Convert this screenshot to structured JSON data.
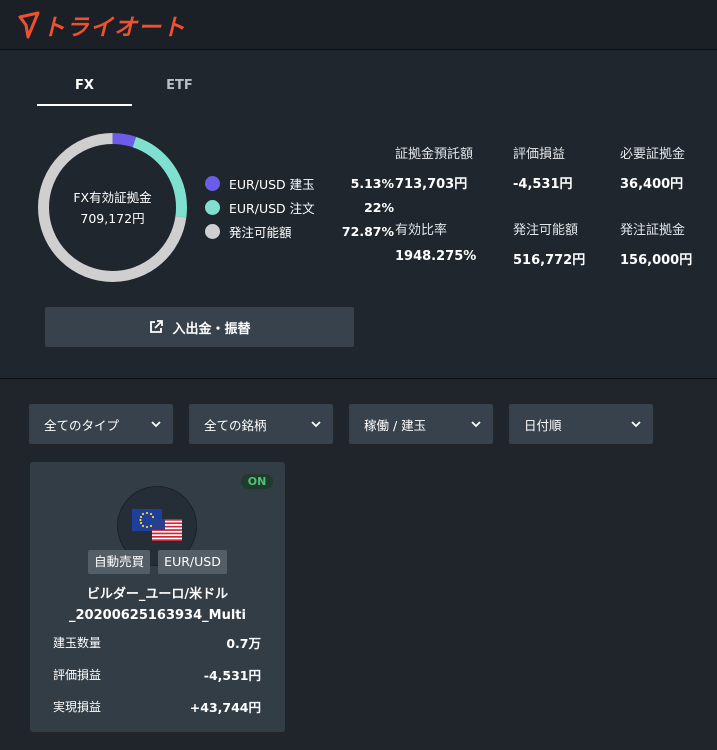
{
  "header": {
    "logo_text": "トライオート"
  },
  "tabs": [
    {
      "label": "FX",
      "active": true
    },
    {
      "label": "ETF",
      "active": false
    }
  ],
  "summary": {
    "donut_title": "FX有効証拠金",
    "donut_value": "709,172円",
    "legend": [
      {
        "label": "EUR/USD 建玉",
        "value": "5.13%",
        "percent": 5.13,
        "color": "#6c5ce7"
      },
      {
        "label": "EUR/USD 注文",
        "value": "22%",
        "percent": 22,
        "color": "#7fe0cf"
      },
      {
        "label": "発注可能額",
        "value": "72.87%",
        "percent": 72.87,
        "color": "#cfcfcf"
      }
    ]
  },
  "stats": [
    {
      "label": "証拠金預託額",
      "value": "713,703円"
    },
    {
      "label": "評価損益",
      "value": "-4,531円"
    },
    {
      "label": "必要証拠金",
      "value": "36,400円"
    },
    {
      "label": "有効比率",
      "value": "1948.275%"
    },
    {
      "label": "発注可能額",
      "value": "516,772円"
    },
    {
      "label": "発注証拠金",
      "value": "156,000円"
    }
  ],
  "deposit_button": {
    "label": "入出金・振替",
    "icon": "external-link-icon"
  },
  "filters": [
    {
      "label": "全てのタイプ"
    },
    {
      "label": "全ての銘柄"
    },
    {
      "label": "稼働 / 建玉"
    },
    {
      "label": "日付順"
    }
  ],
  "card": {
    "status": "ON",
    "tags": [
      "自動売買",
      "EUR/USD"
    ],
    "title_line1": "ビルダー_ユーロ/米ドル",
    "title_line2": "_20200625163934_Multi",
    "rows": [
      {
        "label": "建玉数量",
        "value": "0.7万"
      },
      {
        "label": "評価損益",
        "value": "-4,531円"
      },
      {
        "label": "実現損益",
        "value": "+43,744円"
      }
    ]
  },
  "colors": {
    "brand": "#f1502f",
    "status_on": "#4fc37c"
  }
}
